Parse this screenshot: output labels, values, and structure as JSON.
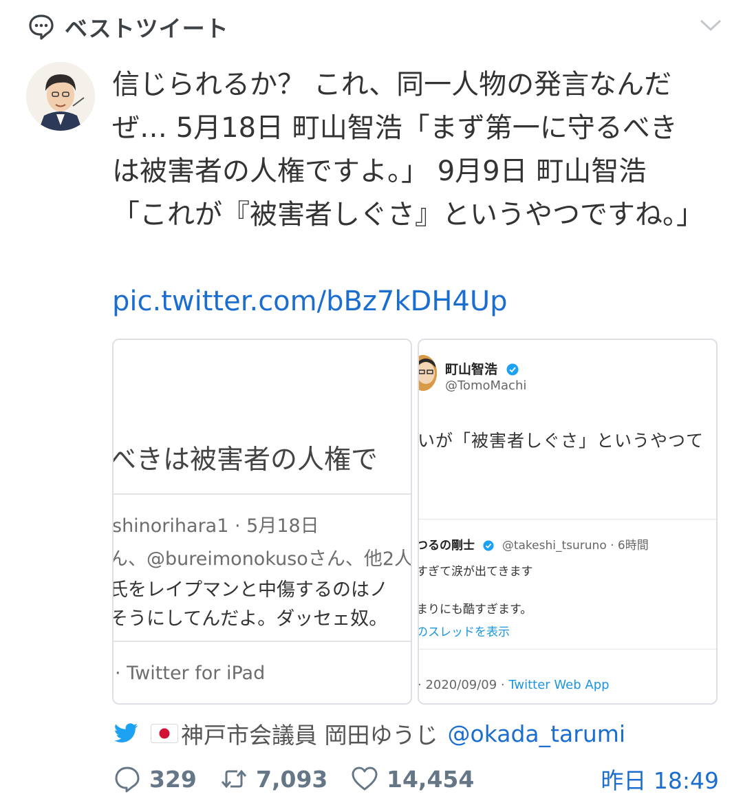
{
  "header": {
    "title": "ベストツイート"
  },
  "tweet": {
    "text": "信じられるか？ これ、同一人物の発言なんだぜ… 5月18日 町山智浩「まず第一に守るべきは被害者の人権ですよ。」 9月9日 町山智浩「これが『被害者しぐさ』というやつですね。」",
    "link": "pic.twitter.com/bBz7kDH4Up"
  },
  "media": {
    "left": {
      "big_text": "べきは被害者の人権で",
      "meta": "shinorihara1 · 5月18日",
      "reply_line": "ん、@bureimonokusoさん、他2人",
      "quote_line1": "氏をレイプマンと中傷するのはノ",
      "quote_line2": "そうにしてんだよ。ダッセェ奴。",
      "footer": "· Twitter for iPad"
    },
    "right": {
      "name": "町山智浩",
      "handle": "@TomoMachi",
      "text": "いが「被害者しぐさ」というやつて",
      "quoted_name": "つるの剛士",
      "quoted_handle": "@takeshi_tsuruno · 6時間",
      "quoted_line1": "すぎて涙が出てきます",
      "quoted_line2": "まりにも酷すぎます。",
      "quoted_link": "のスレッドを表示",
      "footer_date": "· 2020/09/09 · ",
      "footer_app": "Twitter Web App"
    }
  },
  "attribution": {
    "name": "神戸市会議員 岡田ゆうじ",
    "handle": "@okada_tarumi"
  },
  "actions": {
    "replies": "329",
    "retweets": "7,093",
    "likes": "14,454",
    "time": "昨日 18:49"
  },
  "colors": {
    "link": "#1b6ecf",
    "twitter_blue": "#1da1f2",
    "meta_gray": "#657786"
  },
  "icons": [
    "speech-bubble-icon",
    "chevron-down-icon",
    "twitter-bird-icon",
    "japan-flag-icon",
    "reply-icon",
    "retweet-icon",
    "like-icon",
    "verified-icon"
  ]
}
